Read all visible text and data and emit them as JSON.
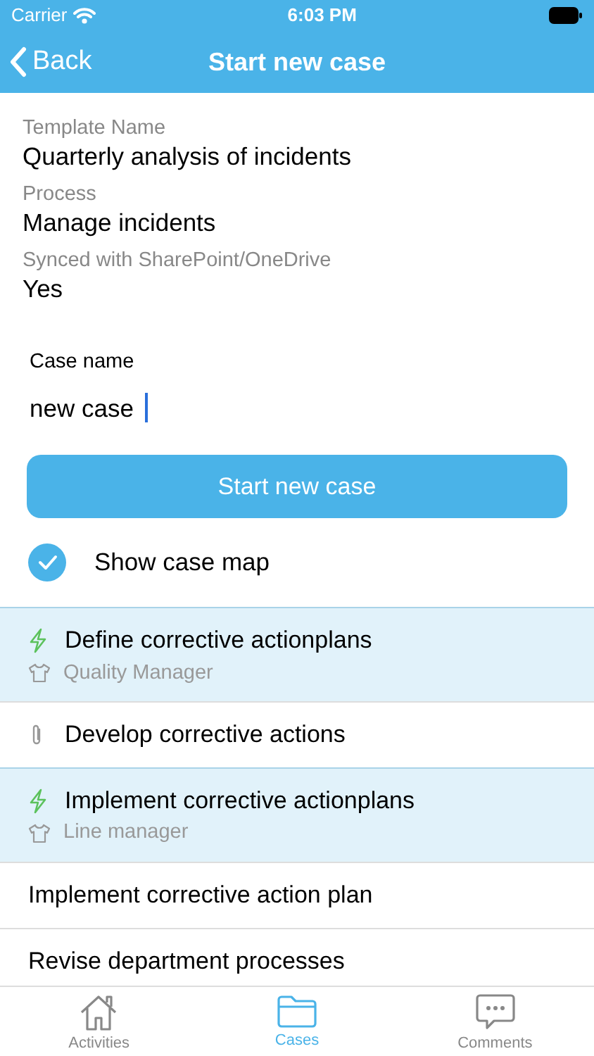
{
  "status_bar": {
    "carrier": "Carrier",
    "time": "6:03 PM"
  },
  "nav": {
    "back": "Back",
    "title": "Start new case"
  },
  "info": [
    {
      "label": "Template Name",
      "value": "Quarterly analysis of incidents"
    },
    {
      "label": "Process",
      "value": "Manage incidents"
    },
    {
      "label": "Synced with SharePoint/OneDrive",
      "value": "Yes"
    }
  ],
  "case_name": {
    "label": "Case name",
    "value": "new case"
  },
  "start_button": "Start new case",
  "show_case_map": {
    "label": "Show case map",
    "checked": true
  },
  "steps": [
    {
      "kind": "trigger",
      "title": "Define corrective actionplans",
      "role": "Quality Manager",
      "selected": true
    },
    {
      "kind": "attachment",
      "title": "Develop corrective actions",
      "selected": false
    },
    {
      "kind": "trigger",
      "title": "Implement corrective actionplans",
      "role": "Line manager",
      "selected": true
    },
    {
      "kind": "plain",
      "title": "Implement corrective action plan",
      "selected": false
    },
    {
      "kind": "plain",
      "title": "Revise department processes",
      "selected": false
    }
  ],
  "tabs": [
    {
      "label": "Activities",
      "kind": "house",
      "selected": false
    },
    {
      "label": "Cases",
      "kind": "folder",
      "selected": true
    },
    {
      "label": "Comments",
      "kind": "chat",
      "selected": false
    }
  ]
}
